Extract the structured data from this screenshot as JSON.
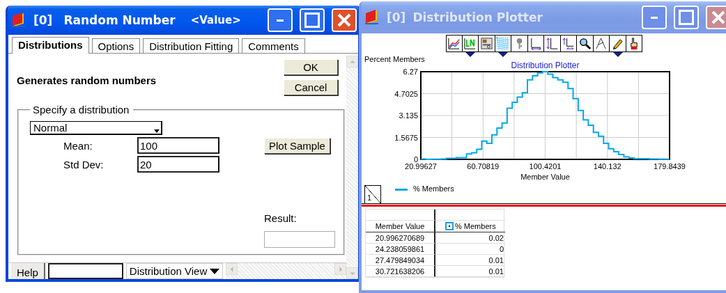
{
  "random_number_window": {
    "active": true,
    "title_id": "[0]",
    "title": "Random Number",
    "title_tag": "<Value>",
    "tabs": [
      {
        "label": "Distributions",
        "selected": true
      },
      {
        "label": "Options",
        "selected": false
      },
      {
        "label": "Distribution Fitting",
        "selected": false
      },
      {
        "label": "Comments",
        "selected": false
      }
    ],
    "description": "Generates random numbers",
    "buttons": [
      "OK",
      "Cancel"
    ],
    "group": {
      "label": "Specify a distribution",
      "distribution": {
        "value": "Normal"
      },
      "params": [
        {
          "label": "Mean:",
          "value": "100"
        },
        {
          "label": "Std Dev:",
          "value": "20"
        }
      ],
      "plot_button": "Plot Sample",
      "result": {
        "label": "Result:"
      }
    },
    "bottom_bar": {
      "help": "Help",
      "view": "Distribution View"
    }
  },
  "distribution_plotter_window": {
    "active": false,
    "title_id": "[0]",
    "title": "Distribution Plotter",
    "toolbar": [
      {
        "kind": "lines",
        "has_menu": false
      },
      {
        "kind": "ln",
        "has_menu": true
      },
      {
        "kind": "panel",
        "has_menu": false
      },
      {
        "kind": "grid",
        "has_menu": true
      },
      {
        "kind": "key",
        "has_menu": false
      },
      {
        "kind": "x-range",
        "has_menu": false
      },
      {
        "kind": "y-range",
        "has_menu": false
      },
      {
        "kind": "xy-range",
        "has_menu": false
      },
      {
        "kind": "zoom",
        "has_menu": false
      },
      {
        "kind": "draw",
        "has_menu": false
      },
      {
        "kind": "pencil",
        "has_menu": true
      },
      {
        "kind": "hand",
        "has_menu": false
      }
    ],
    "chart_data": {
      "type": "line",
      "title": "Distribution Plotter",
      "xlabel": "Member Value",
      "ylabel": "Percent Members",
      "grid": true,
      "x": [
        21,
        24.24,
        24.24,
        27.48,
        27.48,
        30.72,
        30.72,
        33.96,
        33.96,
        37.21,
        37.21,
        40.45,
        40.45,
        43.69,
        43.69,
        46.93,
        46.93,
        50.17,
        50.17,
        53.41,
        53.41,
        56.66,
        56.66,
        59.9,
        59.9,
        63.14,
        63.14,
        66.38,
        66.38,
        69.62,
        69.62,
        72.86,
        72.86,
        76.11,
        76.11,
        79.35,
        79.35,
        82.59,
        82.59,
        85.83,
        85.83,
        89.07,
        89.07,
        92.32,
        92.32,
        95.56,
        95.56,
        98.8,
        98.8,
        102.04,
        102.04,
        105.28,
        105.28,
        108.52,
        108.52,
        111.77,
        111.77,
        115.01,
        115.01,
        118.25,
        118.25,
        121.49,
        121.49,
        124.73,
        124.73,
        127.97,
        127.97,
        131.22,
        131.22,
        134.46,
        134.46,
        137.7,
        137.7,
        140.94,
        140.94,
        144.18,
        144.18,
        147.42,
        147.42,
        150.67,
        150.67,
        153.91,
        153.91,
        157.15,
        157.15,
        160.39,
        160.39,
        163.63,
        163.63,
        166.87,
        166.87,
        170.12,
        170.12,
        173.36,
        173.36,
        176.6,
        176.6,
        179.84
      ],
      "series": [
        {
          "name": "% Members",
          "color": "#00a8e8",
          "values": [
            0.02,
            0.02,
            0,
            0,
            0.01,
            0.01,
            0.01,
            0.01,
            0.03,
            0.03,
            0.08,
            0.08,
            0.08,
            0.08,
            0.13,
            0.13,
            0.13,
            0.13,
            0.39,
            0.39,
            0.47,
            0.47,
            0.72,
            0.72,
            1.31,
            1.31,
            1.14,
            1.14,
            1.76,
            1.76,
            2.24,
            2.24,
            2.6,
            2.6,
            3.66,
            3.66,
            4.08,
            4.08,
            4.45,
            4.45,
            4.76,
            4.76,
            5.68,
            5.68,
            5.97,
            5.97,
            6.18,
            6.18,
            6.27,
            6.27,
            6.1,
            6.1,
            5.85,
            5.85,
            5.68,
            5.68,
            5.51,
            5.51,
            5.06,
            5.06,
            4.34,
            4.34,
            3.5,
            3.5,
            2.82,
            2.82,
            2.44,
            2.44,
            1.93,
            1.93,
            1.65,
            1.65,
            1.14,
            1.14,
            0.76,
            0.76,
            0.55,
            0.55,
            0.35,
            0.35,
            0.17,
            0.17,
            0.1,
            0.1,
            0.05,
            0.05,
            0.05,
            0.05,
            0.05,
            0.05,
            0.02,
            0.02,
            0.02,
            0.02,
            0.01,
            0.01,
            0.01,
            0.01
          ]
        }
      ],
      "xlim": [
        20.99627,
        179.8439
      ],
      "ylim": [
        0,
        6.27
      ],
      "xticks": [
        {
          "value": 20.99627,
          "label": "20.99627"
        },
        {
          "value": 60.70819,
          "label": "60.70819"
        },
        {
          "value": 100.4201,
          "label": "100.4201"
        },
        {
          "value": 140.132,
          "label": "140.132"
        },
        {
          "value": 179.8439,
          "label": "179.8439"
        }
      ],
      "yticks": [
        {
          "value": 0,
          "label": "0"
        },
        {
          "value": 1.5675,
          "label": "1.5675"
        },
        {
          "value": 3.135,
          "label": "3.135"
        },
        {
          "value": 4.7025,
          "label": "4.7025"
        },
        {
          "value": 6.27,
          "label": "6.27"
        }
      ]
    },
    "page_tab": "1",
    "table": {
      "columns": [
        "Member Value",
        "% Members"
      ],
      "rows": [
        [
          "20.996270689",
          "0.02"
        ],
        [
          "24.238059861",
          "0"
        ],
        [
          "27.479849034",
          "0.01"
        ],
        [
          "30.721638206",
          "0.01"
        ]
      ]
    }
  }
}
